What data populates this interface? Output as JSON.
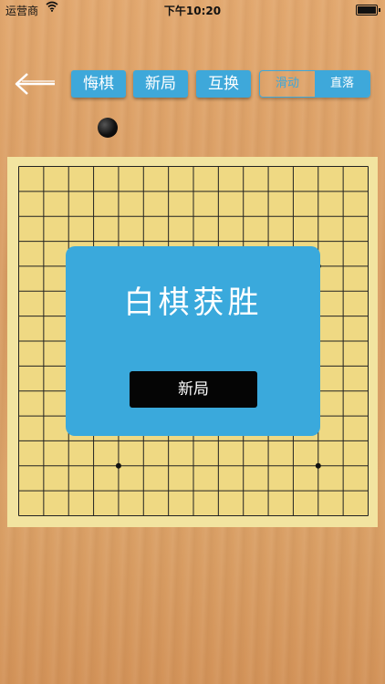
{
  "status_bar": {
    "carrier": "运营商",
    "time": "下午10:20"
  },
  "toolbar": {
    "back_icon": "back-arrow-icon",
    "undo_label": "悔棋",
    "new_game_label": "新局",
    "swap_label": "互换",
    "mode": {
      "options": [
        "滑动",
        "直落"
      ],
      "selected": "直落"
    }
  },
  "turn_indicator": {
    "stone_color": "black"
  },
  "board": {
    "grid_lines": 15,
    "star_points": [
      "4-4",
      "4-12",
      "12-4",
      "12-12"
    ]
  },
  "dialog": {
    "title": "白棋获胜",
    "button_label": "新局"
  },
  "colors": {
    "accent_blue": "#3ea8da",
    "board_yellow": "#efd983",
    "wood": "#dca46a"
  }
}
